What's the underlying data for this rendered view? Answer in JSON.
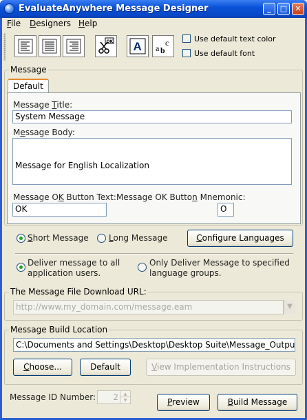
{
  "window": {
    "title": "EvaluateAnywhere Message Designer"
  },
  "menu": {
    "file": "File",
    "designers": "Designers",
    "help": "Help"
  },
  "toolbar": {
    "use_default_text_color": "Use default text color",
    "use_default_font": "Use default font",
    "font_glyph": "A",
    "colour_glyph_a": "a",
    "colour_glyph_b": "b",
    "colour_glyph_c": "c",
    "ok_glyph": "OK"
  },
  "message": {
    "group_label": "Message",
    "tab_default": "Default",
    "title_label_pre": "Message ",
    "title_label_u": "T",
    "title_label_post": "itle:",
    "title_value": "System Message",
    "body_label_pre": "M",
    "body_label_u": "e",
    "body_label_post": "ssage Body:",
    "body_value": "Message for English Localization",
    "ok_text_label_pre": "Message O",
    "ok_text_label_u": "K",
    "ok_text_label_post": " Button Text:",
    "ok_text_value": "OK",
    "mnemonic_label_pre": "Message OK Butto",
    "mnemonic_label_u": "n",
    "mnemonic_label_post": " Mnemonic:",
    "mnemonic_value": "O"
  },
  "options": {
    "short_pre": "",
    "short_u": "S",
    "short_post": "hort Message",
    "long_pre": "",
    "long_u": "L",
    "long_post": "ong Message",
    "configure_pre": "",
    "configure_u": "C",
    "configure_post": "onfigure Languages",
    "deliver_all_line1": "Deliver message to all",
    "deliver_all_line2": "application users.",
    "deliver_groups_line1": "Only Deliver Message to specified",
    "deliver_groups_line2": "language groups.",
    "message_length": "short",
    "delivery": "all"
  },
  "download": {
    "group_label": "The Message File Download URL:",
    "url_value": "http://www.my_domain.com/message.eam"
  },
  "build": {
    "group_label": "Message Build Location",
    "path_value": "C:\\Documents and Settings\\Desktop\\Desktop Suite\\Message_Output_Dir",
    "choose_pre": "",
    "choose_u": "C",
    "choose_post": "hoose...",
    "default_label": "Default",
    "view_impl_pre": "",
    "view_impl_u": "V",
    "view_impl_post": "iew Implementation Instructions"
  },
  "footer": {
    "id_label": "Message ID Number:",
    "id_value": "2",
    "preview_pre": "",
    "preview_u": "P",
    "preview_post": "review",
    "build_pre": "",
    "build_u": "B",
    "build_post": "uild Message"
  }
}
